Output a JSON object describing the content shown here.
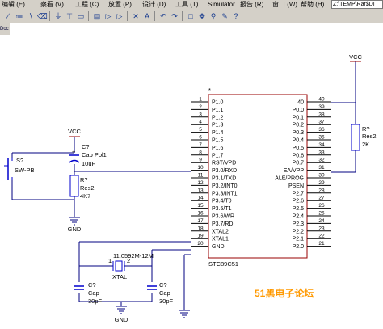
{
  "menu": {
    "items": [
      "编辑 (E)",
      "察看 (V)",
      "工程 (C)",
      "放置 (P)",
      "设计 (D)",
      "工具 (T)",
      "Simulator",
      "报告 (R)",
      "窗口 (W)",
      "帮助 (H)"
    ],
    "path": "Z:\\TEMP\\Rar$DI"
  },
  "left_tab": "Doc",
  "toolbar_icons": [
    "wire-tool",
    "bus-tool",
    "bus-entry-tool",
    "net-label-tool",
    "gnd-tool",
    "vcc-tool",
    "part-tool",
    "sheet-symbol-tool",
    "sheet-entry-tool",
    "port-tool",
    "no-erc-tool",
    "text-tool",
    "undo-tool",
    "redo-tool",
    "select-tool",
    "move-tool",
    "zoom-tool",
    "probe-tool",
    "help-tool"
  ],
  "chip": {
    "ref": "*",
    "name": "STC89C51",
    "left_pins": [
      {
        "num": "1",
        "name": "P1.0"
      },
      {
        "num": "2",
        "name": "P1.1"
      },
      {
        "num": "3",
        "name": "P1.2"
      },
      {
        "num": "4",
        "name": "P1.3"
      },
      {
        "num": "5",
        "name": "P1.4"
      },
      {
        "num": "6",
        "name": "P1.5"
      },
      {
        "num": "7",
        "name": "P1.6"
      },
      {
        "num": "8",
        "name": "P1.7"
      },
      {
        "num": "9",
        "name": "RST/VPD"
      },
      {
        "num": "10",
        "name": "P3.0/RXD"
      },
      {
        "num": "11",
        "name": "P3.1/TXD"
      },
      {
        "num": "12",
        "name": "P3.2/INT0"
      },
      {
        "num": "13",
        "name": "P3.3/INT1"
      },
      {
        "num": "14",
        "name": "P3.4/T0"
      },
      {
        "num": "15",
        "name": "P3.5/T1"
      },
      {
        "num": "16",
        "name": "P3.6/WR"
      },
      {
        "num": "17",
        "name": "P3.7/RD"
      },
      {
        "num": "18",
        "name": "XTAL2"
      },
      {
        "num": "19",
        "name": "XTAL1"
      },
      {
        "num": "20",
        "name": "GND"
      }
    ],
    "right_pins": [
      {
        "num": "40",
        "name": "40"
      },
      {
        "num": "39",
        "name": "P0.0"
      },
      {
        "num": "38",
        "name": "P0.1"
      },
      {
        "num": "37",
        "name": "P0.2"
      },
      {
        "num": "36",
        "name": "P0.3"
      },
      {
        "num": "35",
        "name": "P0.4"
      },
      {
        "num": "34",
        "name": "P0.5"
      },
      {
        "num": "33",
        "name": "P0.6"
      },
      {
        "num": "32",
        "name": "P0.7"
      },
      {
        "num": "31",
        "name": "EA/VPP"
      },
      {
        "num": "30",
        "name": "ALE/PROG"
      },
      {
        "num": "29",
        "name": "PSEN"
      },
      {
        "num": "28",
        "name": "P2.7"
      },
      {
        "num": "27",
        "name": "P2.6"
      },
      {
        "num": "26",
        "name": "P2.5"
      },
      {
        "num": "25",
        "name": "P2.4"
      },
      {
        "num": "24",
        "name": "P2.3"
      },
      {
        "num": "23",
        "name": "P2.2"
      },
      {
        "num": "22",
        "name": "P2.1"
      },
      {
        "num": "21",
        "name": "P2.0"
      }
    ]
  },
  "parts": {
    "vcc_right": "VCC",
    "r_right": {
      "ref": "R?",
      "type": "Res2",
      "value": "2K"
    },
    "vcc_left": "VCC",
    "c_top": {
      "ref": "C?",
      "type": "Cap Pol1",
      "value": "10uF"
    },
    "sw": {
      "ref": "S?",
      "type": "SW-PB"
    },
    "r_left": {
      "ref": "R?",
      "type": "Res2",
      "value": "4K7"
    },
    "gnd_left": "GND",
    "crystal": {
      "ref": "Y?",
      "type": "XTAL",
      "value": "11.0592M-12M",
      "pin1": "1",
      "pin2": "2"
    },
    "c_x1": {
      "ref": "C?",
      "type": "Cap",
      "value": "30pF"
    },
    "c_x2": {
      "ref": "C?",
      "type": "Cap",
      "value": "30pF"
    },
    "gnd_bottom": "GND"
  },
  "watermark": "51黑电子论坛",
  "colors": {
    "wire": "#000080",
    "pin": "#000000",
    "vcc": "#990000",
    "body": "#ffffff",
    "watermark": "#ff9900"
  }
}
